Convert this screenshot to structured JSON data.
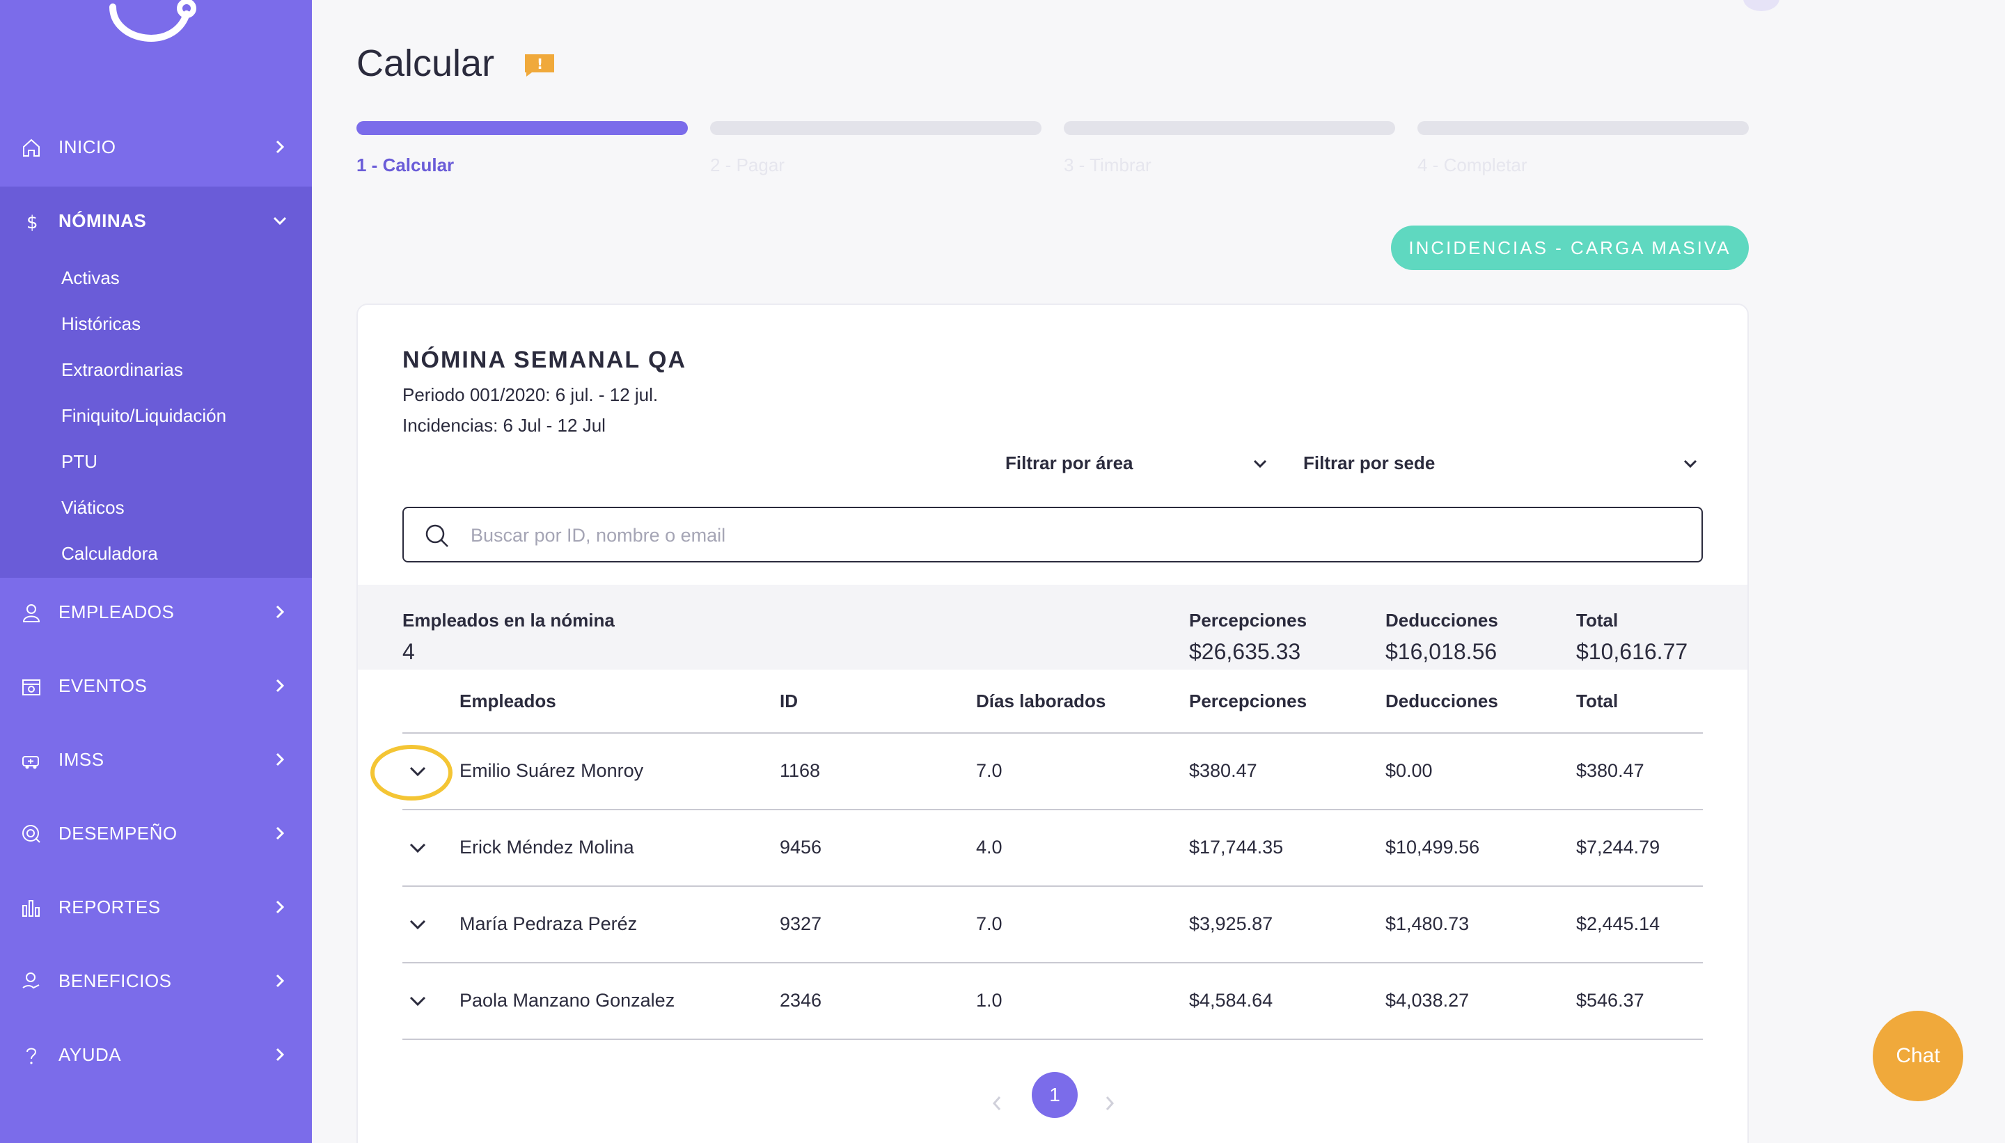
{
  "sidebar": {
    "items": [
      {
        "label": "INICIO",
        "icon": "home-icon"
      },
      {
        "label": "NÓMINAS",
        "icon": "dollar-icon"
      },
      {
        "label": "EMPLEADOS",
        "icon": "user-icon"
      },
      {
        "label": "EVENTOS",
        "icon": "calendar-icon"
      },
      {
        "label": "IMSS",
        "icon": "ambulance-icon"
      },
      {
        "label": "DESEMPEÑO",
        "icon": "performance-icon"
      },
      {
        "label": "REPORTES",
        "icon": "bar-chart-icon"
      },
      {
        "label": "BENEFICIOS",
        "icon": "benefits-icon"
      },
      {
        "label": "AYUDA",
        "icon": "question-icon"
      }
    ],
    "subitems": [
      "Activas",
      "Históricas",
      "Extraordinarias",
      "Finiquito/Liquidación",
      "PTU",
      "Viáticos",
      "Calculadora"
    ]
  },
  "header": {
    "title": "Calcular"
  },
  "steps": [
    {
      "label": "1 - Calcular",
      "active": true
    },
    {
      "label": "2 - Pagar",
      "active": false
    },
    {
      "label": "3 - Timbrar",
      "active": false
    },
    {
      "label": "4 - Completar",
      "active": false
    }
  ],
  "mass_button": "INCIDENCIAS - CARGA MASIVA",
  "card": {
    "title": "NÓMINA SEMANAL QA",
    "period": "Periodo 001/2020: 6 jul. - 12 jul.",
    "incidents": "Incidencias: 6 Jul - 12 Jul",
    "filter_area": "Filtrar por área",
    "filter_site": "Filtrar por sede",
    "search_placeholder": "Buscar por ID, nombre o email"
  },
  "summary": {
    "employees_label": "Empleados en la nómina",
    "employees_value": "4",
    "perceptions_label": "Percepciones",
    "perceptions_value": "$26,635.33",
    "deductions_label": "Deducciones",
    "deductions_value": "$16,018.56",
    "total_label": "Total",
    "total_value": "$10,616.77"
  },
  "table": {
    "headers": [
      "Empleados",
      "ID",
      "Días laborados",
      "Percepciones",
      "Deducciones",
      "Total"
    ],
    "rows": [
      [
        "Emilio Suárez Monroy",
        "1168",
        "7.0",
        "$380.47",
        "$0.00",
        "$380.47"
      ],
      [
        "Erick Méndez Molina",
        "9456",
        "4.0",
        "$17,744.35",
        "$10,499.56",
        "$7,244.79"
      ],
      [
        "María Pedraza Peréz",
        "9327",
        "7.0",
        "$3,925.87",
        "$1,480.73",
        "$2,445.14"
      ],
      [
        "Paola Manzano Gonzalez",
        "2346",
        "1.0",
        "$4,584.64",
        "$4,038.27",
        "$546.37"
      ]
    ]
  },
  "pagination": {
    "current": "1"
  },
  "chat": {
    "label": "Chat"
  },
  "colors": {
    "sidebar": "#7b6cea",
    "sidebar_open": "#6a5cd8",
    "accent": "#7b6cea",
    "teal_button": "#5fd8c0",
    "chat": "#f0a93b",
    "highlight": "#f4c534"
  }
}
